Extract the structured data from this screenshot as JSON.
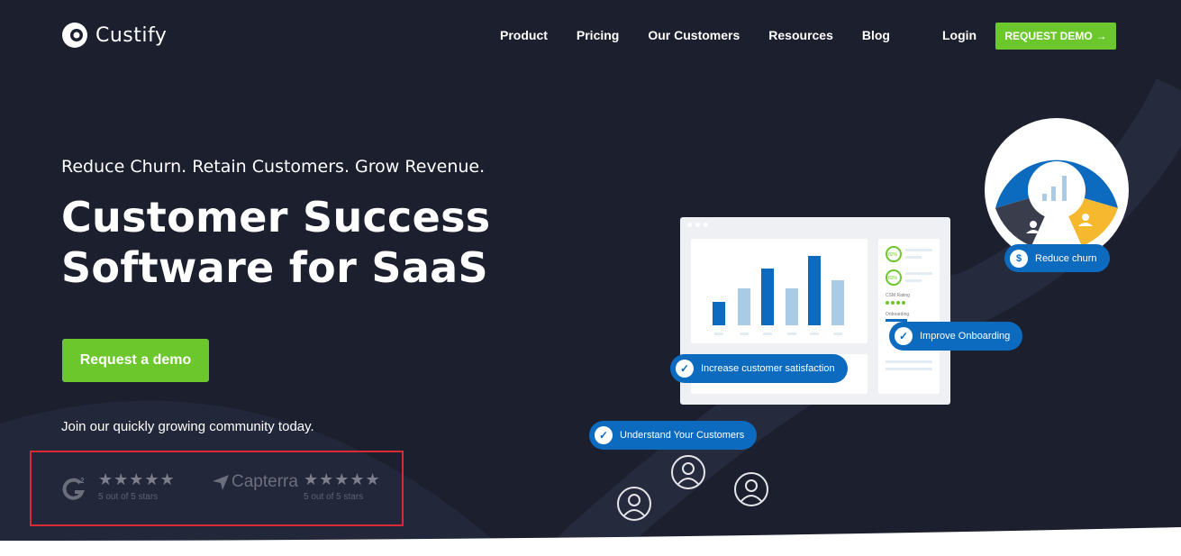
{
  "brand": {
    "name": "Custify"
  },
  "nav": {
    "items": [
      "Product",
      "Pricing",
      "Our Customers",
      "Resources",
      "Blog"
    ],
    "login": "Login",
    "request_demo": "REQUEST DEMO",
    "request_demo_arrow": "→"
  },
  "hero": {
    "tagline": "Reduce Churn. Retain Customers. Grow Revenue.",
    "title_line1": "Customer Success",
    "title_line2": "Software for SaaS",
    "cta": "Request a demo",
    "community": "Join our quickly growing community today."
  },
  "ratings": {
    "g2": {
      "logo": "G",
      "stars": "★★★★★",
      "caption": "5 out of 5 stars",
      "score": 5
    },
    "capterra": {
      "logo": "Capterra",
      "stars": "★★★★★",
      "caption": "5 out of 5 stars",
      "score": 5
    }
  },
  "illustration": {
    "pills": {
      "reduce_churn": "Reduce churn",
      "improve_onboarding": "Improve Onboarding",
      "increase_satisfaction": "Increase customer satisfaction",
      "understand": "Understand Your Customers"
    },
    "dash_labels": {
      "pct1": "82%",
      "pct2": "82%",
      "csm": "CSM Rating",
      "onboarding": "Onboarding"
    }
  },
  "colors": {
    "bg": "#1c1f2e",
    "accent_green": "#6cc72c",
    "accent_blue": "#0c6bbf",
    "highlight_red": "#d82a34",
    "yellow": "#f5b82e"
  }
}
